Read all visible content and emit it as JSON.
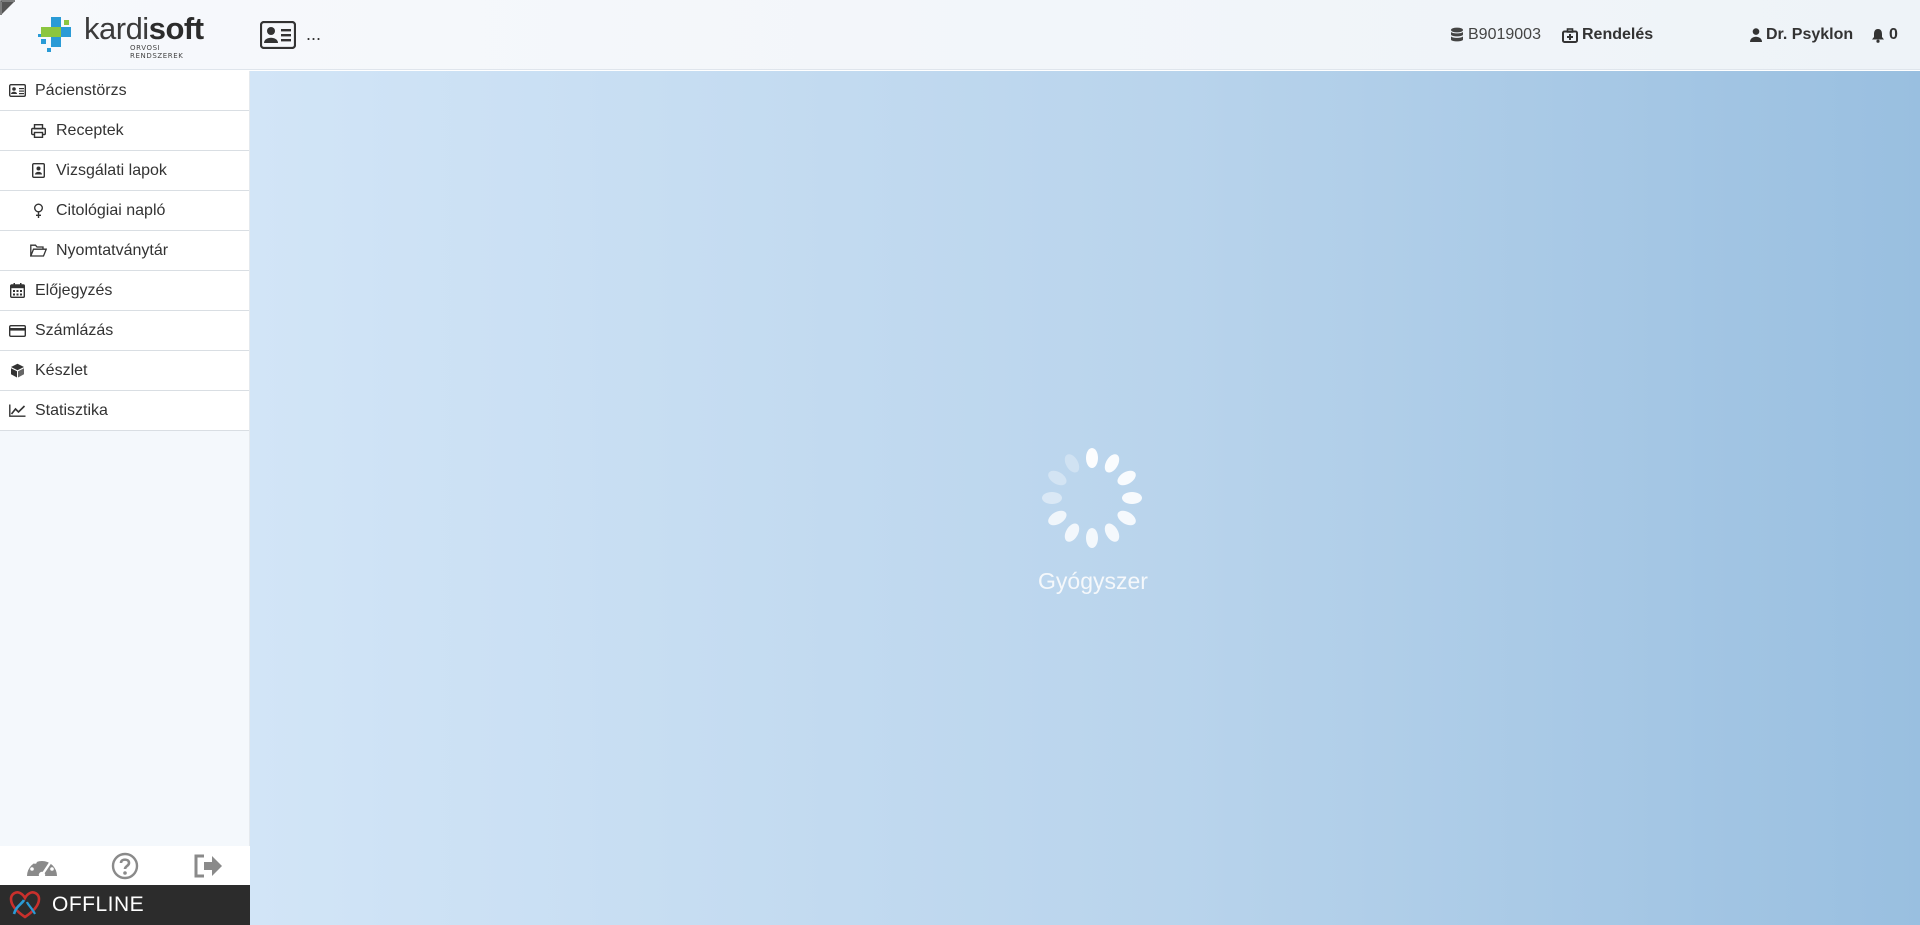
{
  "app": {
    "logo": {
      "name_light": "kardi",
      "name_bold": "soft",
      "subtitle": "ORVOSI RENDSZEREK"
    },
    "header": {
      "patient_placeholder": "...",
      "database_code": "B9019003",
      "office_label": "Rendelés",
      "user_name": "Dr. Psyklon",
      "notification_count": "0"
    }
  },
  "sidebar": {
    "items": [
      {
        "label": "Pácienstörzs",
        "icon": "patient-card-icon"
      },
      {
        "label": "Receptek",
        "icon": "printer-icon"
      },
      {
        "label": "Vizsgálati lapok",
        "icon": "exam-sheet-icon"
      },
      {
        "label": "Citológiai napló",
        "icon": "venus-icon"
      },
      {
        "label": "Nyomtatványtár",
        "icon": "folder-open-icon"
      },
      {
        "label": "Előjegyzés",
        "icon": "calendar-icon"
      },
      {
        "label": "Számlázás",
        "icon": "credit-card-icon"
      },
      {
        "label": "Készlet",
        "icon": "cube-icon"
      },
      {
        "label": "Statisztika",
        "icon": "line-chart-icon"
      }
    ],
    "bottom": [
      "dashboard-icon",
      "help-icon",
      "logout-icon"
    ],
    "status": "OFFLINE"
  },
  "main": {
    "loading_label": "Gyógyszer"
  },
  "colors": {
    "accent_green": "#8cc63f",
    "accent_blue": "#2a9bd6",
    "offline_bar": "#2c2c2c",
    "main_gradient_start": "#d2e5f7",
    "main_gradient_end": "#99bfe0"
  }
}
